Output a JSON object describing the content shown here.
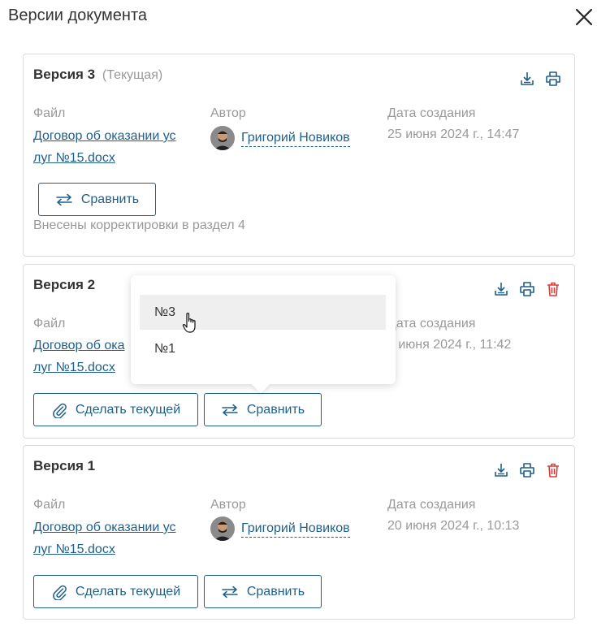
{
  "modal": {
    "title": "Версии документа"
  },
  "columns": {
    "file": "Файл",
    "author": "Автор",
    "date": "Дата создания"
  },
  "versions": [
    {
      "title": "Версия 3",
      "current_label": "(Текущая)",
      "file_line1": "Договор об оказании ус",
      "file_line2": "луг №15.docx",
      "author": "Григорий Новиков",
      "date": "25 июня 2024 г., 14:47",
      "compare_label": "Сравнить",
      "comment": "Внесены корректировки в раздел 4"
    },
    {
      "title": "Версия 2",
      "file_line1": "Договор об ока",
      "file_line2": "луг №15.docx",
      "date": "4 июня 2024 г., 11:42",
      "make_current_label": "Сделать текущей",
      "compare_label": "Сравнить"
    },
    {
      "title": "Версия 1",
      "file_line1": "Договор об оказании ус",
      "file_line2": "луг №15.docx",
      "author": "Григорий Новиков",
      "date": "20 июня 2024 г., 10:13",
      "make_current_label": "Сделать текущей",
      "compare_label": "Сравнить"
    }
  ],
  "compare_dropdown": {
    "items": [
      "№3",
      "№1"
    ],
    "hovered_index": 0
  },
  "icons": [
    "close-icon",
    "download-icon",
    "print-icon",
    "delete-icon",
    "compare-arrows-icon",
    "paperclip-icon"
  ],
  "colors": {
    "link": "#1f5f8b",
    "delete": "#d93a3a",
    "muted": "#999999",
    "border": "#dcdcdc",
    "hover_row": "#efefef"
  }
}
